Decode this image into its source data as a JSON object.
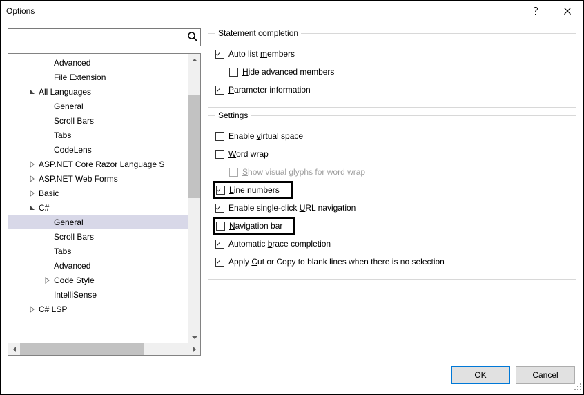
{
  "title": "Options",
  "search": {
    "value": "",
    "placeholder": ""
  },
  "tree": [
    {
      "label": "Advanced",
      "depth": 2,
      "toggle": "none",
      "selected": false
    },
    {
      "label": "File Extension",
      "depth": 2,
      "toggle": "none",
      "selected": false
    },
    {
      "label": "All Languages",
      "depth": 1,
      "toggle": "open",
      "selected": false
    },
    {
      "label": "General",
      "depth": 2,
      "toggle": "none",
      "selected": false
    },
    {
      "label": "Scroll Bars",
      "depth": 2,
      "toggle": "none",
      "selected": false
    },
    {
      "label": "Tabs",
      "depth": 2,
      "toggle": "none",
      "selected": false
    },
    {
      "label": "CodeLens",
      "depth": 2,
      "toggle": "none",
      "selected": false
    },
    {
      "label": "ASP.NET Core Razor Language S",
      "depth": 1,
      "toggle": "closed",
      "selected": false
    },
    {
      "label": "ASP.NET Web Forms",
      "depth": 1,
      "toggle": "closed",
      "selected": false
    },
    {
      "label": "Basic",
      "depth": 1,
      "toggle": "closed",
      "selected": false
    },
    {
      "label": "C#",
      "depth": 1,
      "toggle": "open",
      "selected": false
    },
    {
      "label": "General",
      "depth": 2,
      "toggle": "none",
      "selected": true
    },
    {
      "label": "Scroll Bars",
      "depth": 2,
      "toggle": "none",
      "selected": false
    },
    {
      "label": "Tabs",
      "depth": 2,
      "toggle": "none",
      "selected": false
    },
    {
      "label": "Advanced",
      "depth": 2,
      "toggle": "none",
      "selected": false
    },
    {
      "label": "Code Style",
      "depth": 2,
      "toggle": "closed",
      "selected": false
    },
    {
      "label": "IntelliSense",
      "depth": 2,
      "toggle": "none",
      "selected": false
    },
    {
      "label": "C# LSP",
      "depth": 1,
      "toggle": "closed",
      "selected": false
    }
  ],
  "group1": {
    "legend": "Statement completion",
    "auto_members": {
      "checked": true,
      "pre": "Auto list ",
      "ul": "m",
      "post": "embers"
    },
    "hide_adv": {
      "checked": false,
      "pre": "",
      "ul": "H",
      "post": "ide advanced members"
    },
    "param_info": {
      "checked": true,
      "pre": "",
      "ul": "P",
      "post": "arameter information"
    }
  },
  "group2": {
    "legend": "Settings",
    "virtual_space": {
      "checked": false,
      "pre": "Enable ",
      "ul": "v",
      "post": "irtual space"
    },
    "word_wrap": {
      "checked": false,
      "pre": "",
      "ul": "W",
      "post": "ord wrap"
    },
    "show_glyphs": {
      "checked": false,
      "disabled": true,
      "pre": "",
      "ul": "S",
      "post": "how visual glyphs for word wrap"
    },
    "line_numbers": {
      "checked": true,
      "pre": "",
      "ul": "L",
      "post": "ine numbers",
      "emphasized": true
    },
    "url_nav": {
      "checked": true,
      "pre": "Enable single-click ",
      "ul": "U",
      "post": "RL navigation"
    },
    "nav_bar": {
      "checked": false,
      "pre": "",
      "ul": "N",
      "post": "avigation bar",
      "emphasized": true
    },
    "brace": {
      "checked": true,
      "pre": "Automatic ",
      "ul": "b",
      "post": "race completion"
    },
    "cut_copy": {
      "checked": true,
      "pre": "Apply ",
      "ul": "C",
      "post": "ut or Copy to blank lines when there is no selection"
    }
  },
  "buttons": {
    "ok": "OK",
    "cancel": "Cancel"
  }
}
